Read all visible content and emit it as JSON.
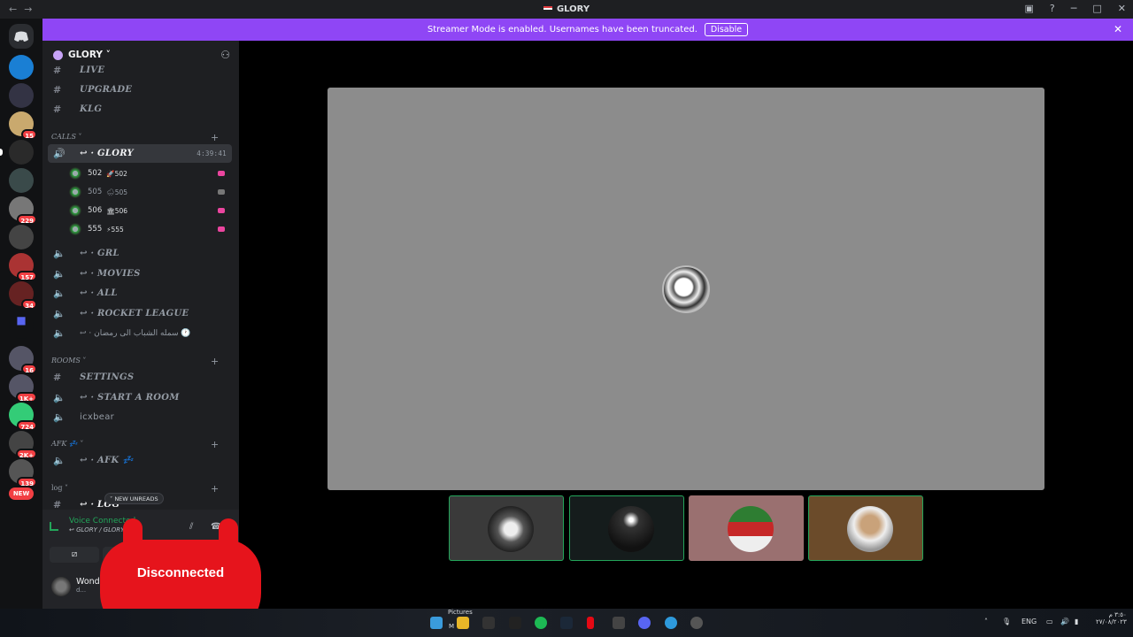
{
  "window": {
    "title": "GLORY",
    "nav_back": "←",
    "nav_fwd": "→"
  },
  "banner": {
    "text": "Streamer Mode is enabled. Usernames have been truncated.",
    "disable": "Disable",
    "close": "✕"
  },
  "rail_badges": [
    "15",
    "229",
    "157",
    "34",
    "16",
    "1K+",
    "724",
    "2K+",
    "139",
    "NEW"
  ],
  "server": {
    "name": "GLORY ˅"
  },
  "channels": {
    "live": "LIVE",
    "upgrade": "UPGRADE",
    "klg": "KLG",
    "calls_cat": "CALLS ˅",
    "glory": "↩ · GLORY",
    "glory_time": "4:39:41",
    "users": [
      {
        "id": "502",
        "tag": "🚀502"
      },
      {
        "id": "505",
        "tag": "🌧505"
      },
      {
        "id": "506",
        "tag": "🏛506"
      },
      {
        "id": "555",
        "tag": "⚡555"
      }
    ],
    "grl": "↩ · GRL",
    "movies": "↩ · MOVIES",
    "all": "↩ · ALL",
    "rocket": "↩ · ROCKET LEAGUE",
    "arabic": "↩ · سمله الشباب الى رمضان 🕐",
    "rooms_cat": "ROOMS ˅",
    "settings": "SETTINGS",
    "start_room": "↩ · START A ROOM",
    "icxbear": "icxbear",
    "afk_cat": "AFK 💤 ˅",
    "afk": "↩ · AFK 💤",
    "log_cat": "log ˅",
    "log": "↩ · LOG",
    "new_unreads": "˅ NEW UNREADS"
  },
  "voice": {
    "status": "Voice Connected",
    "where": "↩ GLORY / GLORY",
    "user": "Wonder",
    "user_sub": "d..."
  },
  "overlay": {
    "text": "Disconnected"
  },
  "taskbar": {
    "lang": "ENG",
    "time": "٣:٥٠ م",
    "date": "٢٧/٠٨/٢٠٢٣",
    "pictures": "Pictures",
    "m": "M"
  }
}
